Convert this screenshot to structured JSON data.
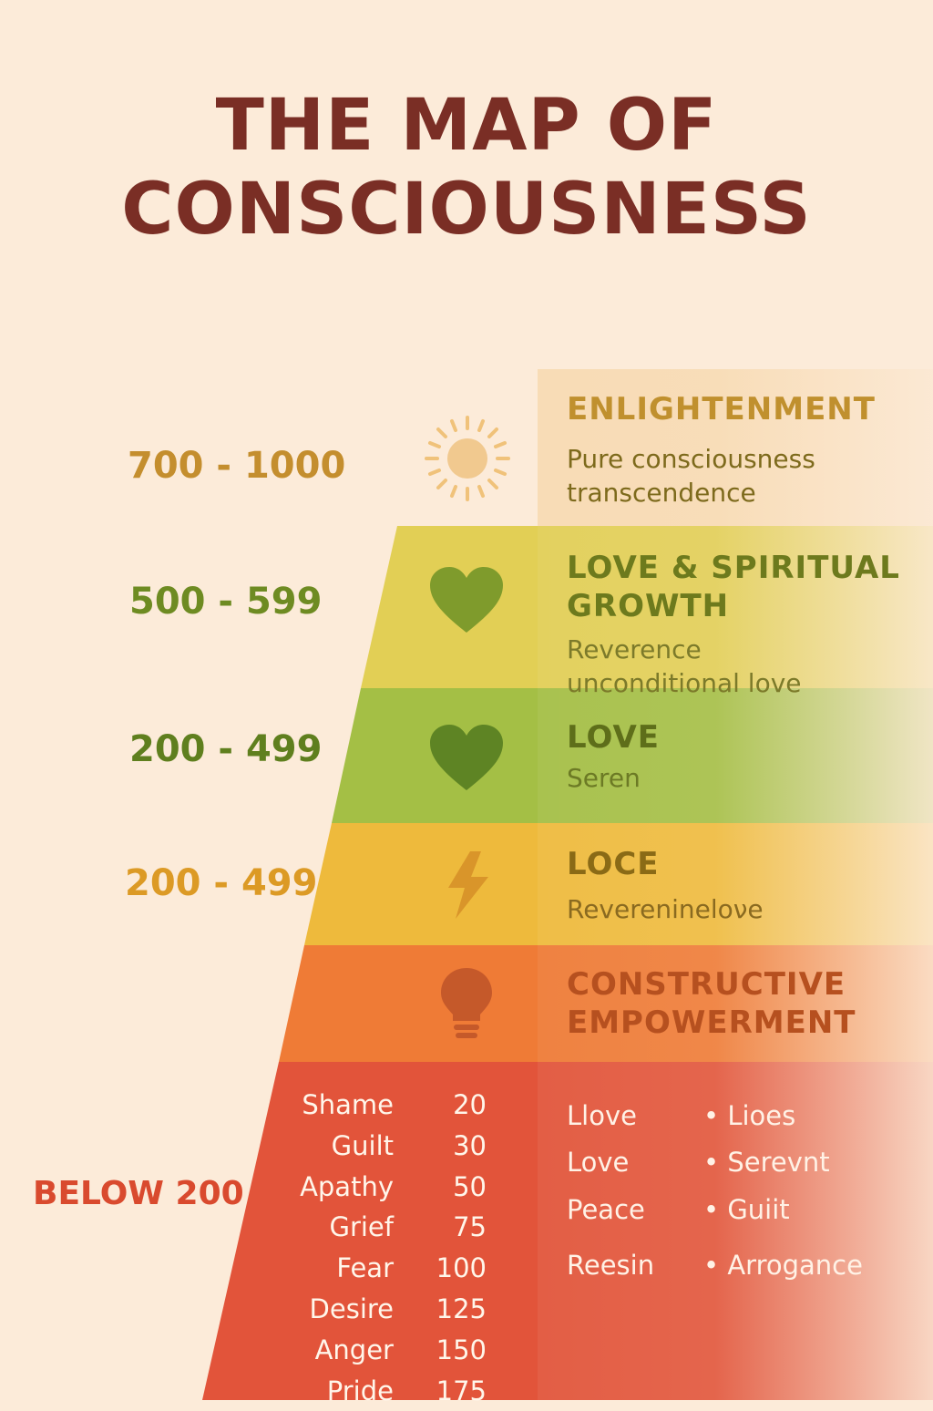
{
  "title": {
    "line1": "THE MAP OF",
    "line2": "CONSCIOUSNESS"
  },
  "colors": {
    "background": "#fcebd9",
    "title": "#7a2e25",
    "tier_enlightenment": "#b98a2c",
    "tier_love_spiritual": "#e2cf55",
    "tier_love": "#a4bf45",
    "tier_loce": "#eeba3c",
    "tier_constructive": "#ef7b36",
    "tier_below": "#e2543a"
  },
  "tiers": [
    {
      "range": "700 - 1000",
      "icon": "sun-icon",
      "title": "ENLIGHTENMENT",
      "description_lines": [
        "Pure consciousness",
        "transcendence"
      ]
    },
    {
      "range": "500 - 599",
      "icon": "heart-icon",
      "title_lines": [
        "LOVE & SPIRITUAL",
        "GROWTH"
      ],
      "description_lines": [
        "Reverence",
        "unconditional love"
      ]
    },
    {
      "range": "200 - 499",
      "icon": "heart-icon",
      "title": "LOVE",
      "description": "Seren"
    },
    {
      "range": "200 - 499",
      "icon": "lightning-icon",
      "title": "LOCE",
      "description": "Reverenineloνe"
    },
    {
      "icon": "lightbulb-icon",
      "title_lines": [
        "CONSTRUCTIVE",
        "EMPOWERMENT"
      ]
    },
    {
      "range": "BELOW 200"
    }
  ],
  "emotions": [
    {
      "name": "Shame",
      "value": "20"
    },
    {
      "name": "Guilt",
      "value": "30"
    },
    {
      "name": "Apathy",
      "value": "50"
    },
    {
      "name": "Grief",
      "value": "75"
    },
    {
      "name": "Fear",
      "value": "100"
    },
    {
      "name": "Desire",
      "value": "125"
    },
    {
      "name": "Anger",
      "value": "150"
    },
    {
      "name": "Pride",
      "value": "175"
    }
  ],
  "lower_left_words": [
    "Llove",
    "Love",
    "Peace",
    "Reesin"
  ],
  "lower_right_bullets": [
    "Lioes",
    "Serevnt",
    "Guiit",
    "Arrogance"
  ]
}
